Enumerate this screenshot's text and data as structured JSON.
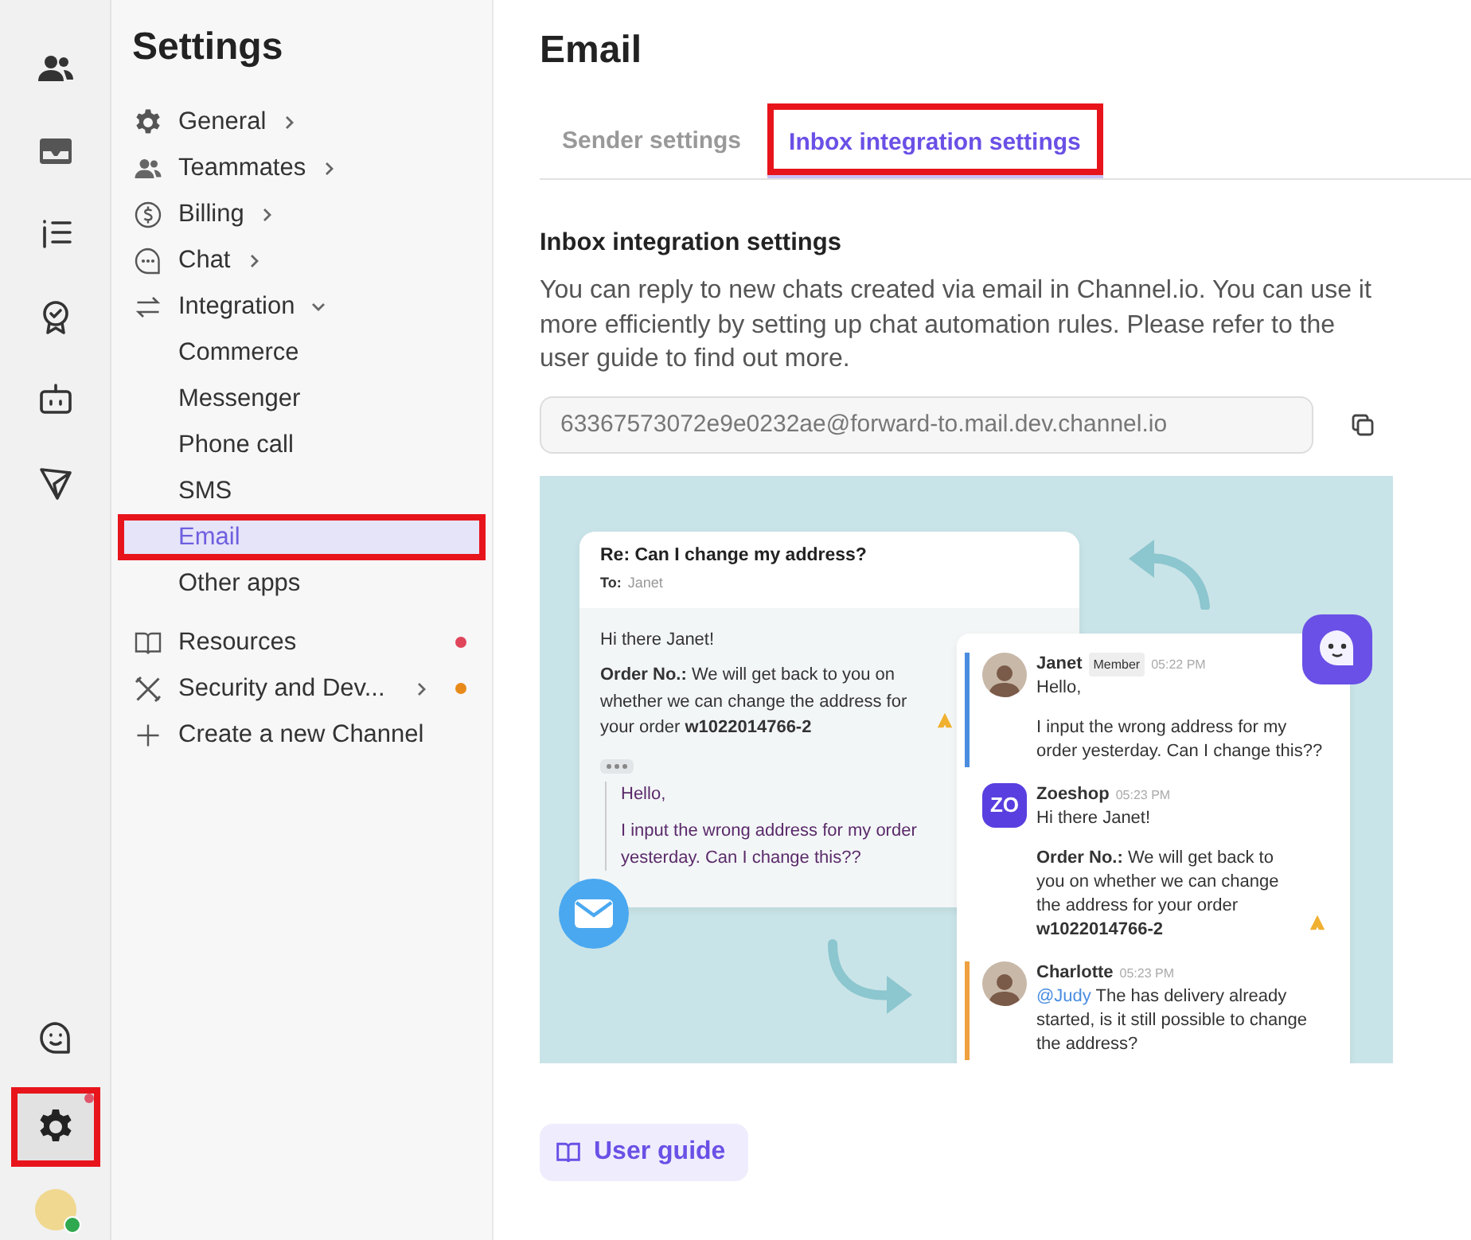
{
  "rail": {
    "top": [
      {
        "selected": false
      },
      {
        "selected": false
      },
      {
        "selected": false
      },
      {
        "selected": false
      },
      {
        "selected": false
      },
      {
        "selected": false
      }
    ],
    "bottom": [
      {
        "selected": false,
        "highlighted": false
      },
      {
        "selected": true,
        "highlighted": true,
        "color": "#e0556a"
      }
    ],
    "avatar": {
      "online": true
    }
  },
  "nav": {
    "title": "Settings",
    "items": [
      {
        "label": "General",
        "chevron": true,
        "expanded": false
      },
      {
        "label": "Teammates",
        "chevron": true,
        "expanded": false
      },
      {
        "label": "Billing",
        "chevron": true,
        "expanded": false
      },
      {
        "label": "Chat",
        "chevron": true,
        "expanded": false
      },
      {
        "label": "Integration",
        "chevron": true,
        "expanded": true,
        "children": [
          {
            "label": "Commerce",
            "selected": false,
            "highlighted": false
          },
          {
            "label": "Messenger",
            "selected": false,
            "highlighted": false
          },
          {
            "label": "Phone call",
            "selected": false,
            "highlighted": false
          },
          {
            "label": "SMS",
            "selected": false,
            "highlighted": false
          },
          {
            "label": "Email",
            "selected": true,
            "highlighted": true
          },
          {
            "label": "Other apps",
            "selected": false,
            "highlighted": false
          }
        ]
      }
    ],
    "more": [
      {
        "label": "Resources",
        "chevron": false,
        "color": "#e0455a"
      },
      {
        "label": "Security and Dev...",
        "chevron": true,
        "color": "#e88a1a"
      },
      {
        "label": "Create a new Channel",
        "chevron": false
      }
    ]
  },
  "page": {
    "title": "Email",
    "tabs": [
      {
        "label": "Sender settings",
        "selected": false,
        "highlighted": false
      },
      {
        "label": "Inbox integration settings",
        "selected": true,
        "highlighted": true
      }
    ],
    "section_title": "Inbox integration settings",
    "description": "You can reply to new chats created via email in Channel.io. You can use it more efficiently by setting up chat automation rules. Please refer to the user guide to find out more.",
    "address_field": {
      "value": "63367573072e9e0232ae@forward-to.mail.dev.channel.io"
    },
    "illustration": {
      "email": {
        "subject": "Re: Can I change my address?",
        "to_label": "To:",
        "to": "Janet",
        "greeting": "Hi there Janet!",
        "body": "**Order No.:** We will get back to you on whether we can change the address for your order **w1022014766-2**",
        "quote": [
          "Hello,",
          "I input the wrong address for my order yesterday. Can I change this??"
        ]
      },
      "chat": [
        {
          "author": "Janet",
          "badge": "Member",
          "time": "05:22 PM",
          "paragraphs": [
            "Hello,",
            "I input the wrong address for my order yesterday. Can I change this??"
          ],
          "color": "#4a8de0"
        },
        {
          "author": "Zoeshop",
          "avatar_text": "ZO",
          "time": "05:23 PM",
          "paragraphs": [
            "Hi there Janet!",
            "**Order No.:** We will get back to you on whether we can change the address for your order **w1022014766-2**"
          ]
        },
        {
          "author": "Charlotte",
          "time": "05:23 PM",
          "mention": "@Judy",
          "paragraphs": [
            "The has delivery already started, is it still possible to change the address?"
          ],
          "color": "#f0a040"
        }
      ]
    },
    "button": "User guide"
  }
}
